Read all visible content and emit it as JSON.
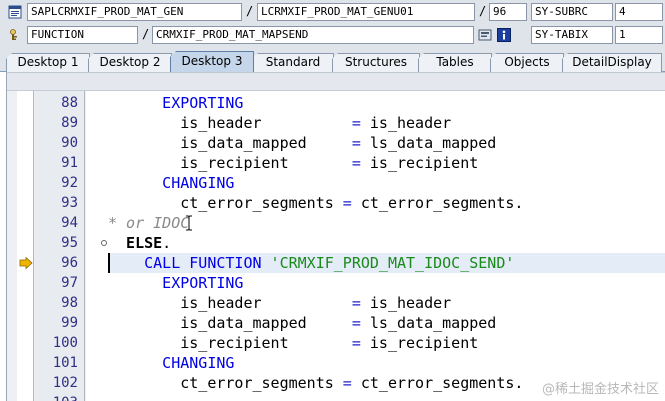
{
  "info": {
    "program": "SAPLCRMXIF_PROD_MAT_GEN",
    "include": "LCRMXIF_PROD_MAT_GENU01",
    "line_no": "96",
    "sy_subrc_label": "SY-SUBRC",
    "sy_subrc_value": "4",
    "event_type": "FUNCTION",
    "event_name": "CRMXIF_PROD_MAT_MAPSEND",
    "sy_tabix_label": "SY-TABIX",
    "sy_tabix_value": "1",
    "separator": "/"
  },
  "tabs": [
    {
      "label": "Desktop 1"
    },
    {
      "label": "Desktop 2"
    },
    {
      "label": "Desktop 3",
      "active": true
    },
    {
      "label": "Standard"
    },
    {
      "label": "Structures"
    },
    {
      "label": "Tables"
    },
    {
      "label": "Objects"
    },
    {
      "label": "DetailDisplay"
    }
  ],
  "code_lines": [
    {
      "num": "88",
      "indent": 6,
      "tokens": [
        {
          "t": "EXPORTING",
          "c": "kw"
        }
      ]
    },
    {
      "num": "89",
      "indent": 8,
      "tokens": [
        {
          "t": "is_header          ",
          "c": ""
        },
        {
          "t": "=",
          "c": "op"
        },
        {
          "t": " is_header",
          "c": ""
        }
      ]
    },
    {
      "num": "90",
      "indent": 8,
      "tokens": [
        {
          "t": "is_data_mapped     ",
          "c": ""
        },
        {
          "t": "=",
          "c": "op"
        },
        {
          "t": " ls_data_mapped",
          "c": ""
        }
      ]
    },
    {
      "num": "91",
      "indent": 8,
      "tokens": [
        {
          "t": "is_recipient       ",
          "c": ""
        },
        {
          "t": "=",
          "c": "op"
        },
        {
          "t": " is_recipient",
          "c": ""
        }
      ]
    },
    {
      "num": "92",
      "indent": 6,
      "tokens": [
        {
          "t": "CHANGING",
          "c": "kw"
        }
      ]
    },
    {
      "num": "93",
      "indent": 8,
      "tokens": [
        {
          "t": "ct_error_segments ",
          "c": ""
        },
        {
          "t": "=",
          "c": "op"
        },
        {
          "t": " ct_error_segments",
          "c": ""
        },
        {
          "t": ".",
          "c": "period"
        }
      ]
    },
    {
      "num": "94",
      "indent": 0,
      "tokens": [
        {
          "t": "* or IDOC",
          "c": "cmt"
        }
      ]
    },
    {
      "num": "95",
      "indent": 2,
      "tokens": [
        {
          "t": "ELSE",
          "c": "kw-bold"
        },
        {
          "t": ".",
          "c": "period"
        }
      ]
    },
    {
      "num": "96",
      "indent": 4,
      "current": true,
      "tokens": [
        {
          "t": "CALL FUNCTION",
          "c": "kw"
        },
        {
          "t": " ",
          "c": ""
        },
        {
          "t": "'CRMXIF_PROD_MAT_IDOC_SEND'",
          "c": "str"
        }
      ]
    },
    {
      "num": "97",
      "indent": 6,
      "tokens": [
        {
          "t": "EXPORTING",
          "c": "kw"
        }
      ]
    },
    {
      "num": "98",
      "indent": 8,
      "tokens": [
        {
          "t": "is_header          ",
          "c": ""
        },
        {
          "t": "=",
          "c": "op"
        },
        {
          "t": " is_header",
          "c": ""
        }
      ]
    },
    {
      "num": "99",
      "indent": 8,
      "tokens": [
        {
          "t": "is_data_mapped     ",
          "c": ""
        },
        {
          "t": "=",
          "c": "op"
        },
        {
          "t": " ls_data_mapped",
          "c": ""
        }
      ]
    },
    {
      "num": "100",
      "indent": 8,
      "tokens": [
        {
          "t": "is_recipient       ",
          "c": ""
        },
        {
          "t": "=",
          "c": "op"
        },
        {
          "t": " is_recipient",
          "c": ""
        }
      ]
    },
    {
      "num": "101",
      "indent": 6,
      "tokens": [
        {
          "t": "CHANGING",
          "c": "kw"
        }
      ]
    },
    {
      "num": "102",
      "indent": 8,
      "tokens": [
        {
          "t": "ct_error_segments ",
          "c": ""
        },
        {
          "t": "=",
          "c": "op"
        },
        {
          "t": " ct_error_segments",
          "c": ""
        },
        {
          "t": ".",
          "c": "period"
        }
      ]
    },
    {
      "num": "103",
      "indent": 0,
      "tokens": []
    }
  ],
  "watermark": "@稀土掘金技术社区",
  "icons": {
    "program": "program-icon",
    "function": "function-module-icon",
    "display": "display-icon",
    "info": "info-icon",
    "exec_arrow": "execution-arrow-icon"
  },
  "colors": {
    "keyword": "#0000e6",
    "string": "#1a8a1a",
    "comment": "#8a8a8a",
    "line_number": "#2f2f86",
    "current_line": "#e4ecf8",
    "exec_arrow": "#f0b400"
  }
}
